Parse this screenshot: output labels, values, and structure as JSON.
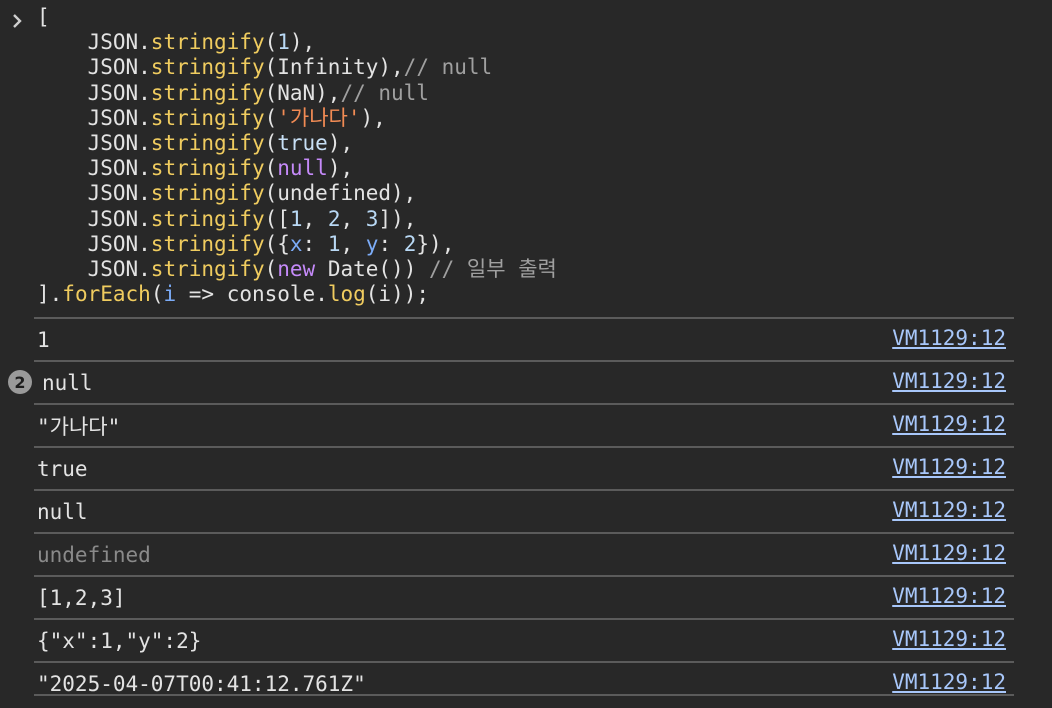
{
  "code_lines": [
    [
      {
        "t": "[",
        "c": "ident"
      }
    ],
    [
      {
        "t": "    JSON.",
        "c": "ident"
      },
      {
        "t": "stringify",
        "c": "kw"
      },
      {
        "t": "(",
        "c": "ident"
      },
      {
        "t": "1",
        "c": "num"
      },
      {
        "t": "),",
        "c": "ident"
      }
    ],
    [
      {
        "t": "    JSON.",
        "c": "ident"
      },
      {
        "t": "stringify",
        "c": "kw"
      },
      {
        "t": "(Infinity),",
        "c": "ident"
      },
      {
        "t": "// null",
        "c": "cm"
      }
    ],
    [
      {
        "t": "    JSON.",
        "c": "ident"
      },
      {
        "t": "stringify",
        "c": "kw"
      },
      {
        "t": "(NaN),",
        "c": "ident"
      },
      {
        "t": "// null",
        "c": "cm"
      }
    ],
    [
      {
        "t": "    JSON.",
        "c": "ident"
      },
      {
        "t": "stringify",
        "c": "kw"
      },
      {
        "t": "(",
        "c": "ident"
      },
      {
        "t": "'가나다'",
        "c": "str"
      },
      {
        "t": "),",
        "c": "ident"
      }
    ],
    [
      {
        "t": "    JSON.",
        "c": "ident"
      },
      {
        "t": "stringify",
        "c": "kw"
      },
      {
        "t": "(",
        "c": "ident"
      },
      {
        "t": "true",
        "c": "bool"
      },
      {
        "t": "),",
        "c": "ident"
      }
    ],
    [
      {
        "t": "    JSON.",
        "c": "ident"
      },
      {
        "t": "stringify",
        "c": "kw"
      },
      {
        "t": "(",
        "c": "ident"
      },
      {
        "t": "null",
        "c": "kwpurple"
      },
      {
        "t": "),",
        "c": "ident"
      }
    ],
    [
      {
        "t": "    JSON.",
        "c": "ident"
      },
      {
        "t": "stringify",
        "c": "kw"
      },
      {
        "t": "(undefined),",
        "c": "ident"
      }
    ],
    [
      {
        "t": "    JSON.",
        "c": "ident"
      },
      {
        "t": "stringify",
        "c": "kw"
      },
      {
        "t": "([",
        "c": "ident"
      },
      {
        "t": "1",
        "c": "num"
      },
      {
        "t": ", ",
        "c": "ident"
      },
      {
        "t": "2",
        "c": "num"
      },
      {
        "t": ", ",
        "c": "ident"
      },
      {
        "t": "3",
        "c": "num"
      },
      {
        "t": "]),",
        "c": "ident"
      }
    ],
    [
      {
        "t": "    JSON.",
        "c": "ident"
      },
      {
        "t": "stringify",
        "c": "kw"
      },
      {
        "t": "({",
        "c": "ident"
      },
      {
        "t": "x",
        "c": "prop"
      },
      {
        "t": ": ",
        "c": "ident"
      },
      {
        "t": "1",
        "c": "num"
      },
      {
        "t": ", ",
        "c": "ident"
      },
      {
        "t": "y",
        "c": "prop"
      },
      {
        "t": ": ",
        "c": "ident"
      },
      {
        "t": "2",
        "c": "num"
      },
      {
        "t": "}),",
        "c": "ident"
      }
    ],
    [
      {
        "t": "    JSON.",
        "c": "ident"
      },
      {
        "t": "stringify",
        "c": "kw"
      },
      {
        "t": "(",
        "c": "ident"
      },
      {
        "t": "new",
        "c": "kwpurple"
      },
      {
        "t": " Date()) ",
        "c": "ident"
      },
      {
        "t": "// 일부 출력",
        "c": "cm"
      }
    ],
    [
      {
        "t": "].",
        "c": "ident"
      },
      {
        "t": "forEach",
        "c": "kw"
      },
      {
        "t": "(",
        "c": "ident"
      },
      {
        "t": "i",
        "c": "prop"
      },
      {
        "t": " => console.",
        "c": "ident"
      },
      {
        "t": "log",
        "c": "kw"
      },
      {
        "t": "(i));",
        "c": "ident"
      }
    ]
  ],
  "outputs": [
    {
      "value": "1",
      "source": "VM1129:12",
      "dim": false,
      "badge": ""
    },
    {
      "value": "null",
      "source": "VM1129:12",
      "dim": false,
      "badge": "2"
    },
    {
      "value": "\"가나다\"",
      "source": "VM1129:12",
      "dim": false,
      "badge": ""
    },
    {
      "value": "true",
      "source": "VM1129:12",
      "dim": false,
      "badge": ""
    },
    {
      "value": "null",
      "source": "VM1129:12",
      "dim": false,
      "badge": ""
    },
    {
      "value": "undefined",
      "source": "VM1129:12",
      "dim": true,
      "badge": ""
    },
    {
      "value": "[1,2,3]",
      "source": "VM1129:12",
      "dim": false,
      "badge": ""
    },
    {
      "value": "{\"x\":1,\"y\":2}",
      "source": "VM1129:12",
      "dim": false,
      "badge": ""
    },
    {
      "value": "\"2025-04-07T00:41:12.761Z\"",
      "source": "VM1129:12",
      "dim": false,
      "badge": ""
    }
  ],
  "colors": {
    "background": "#282828",
    "method": "#f0cc5f",
    "number": "#b9d9f5",
    "string": "#f28b54",
    "comment": "#a0a0a0",
    "keyword": "#c58af9",
    "link": "#a8c7fa"
  }
}
